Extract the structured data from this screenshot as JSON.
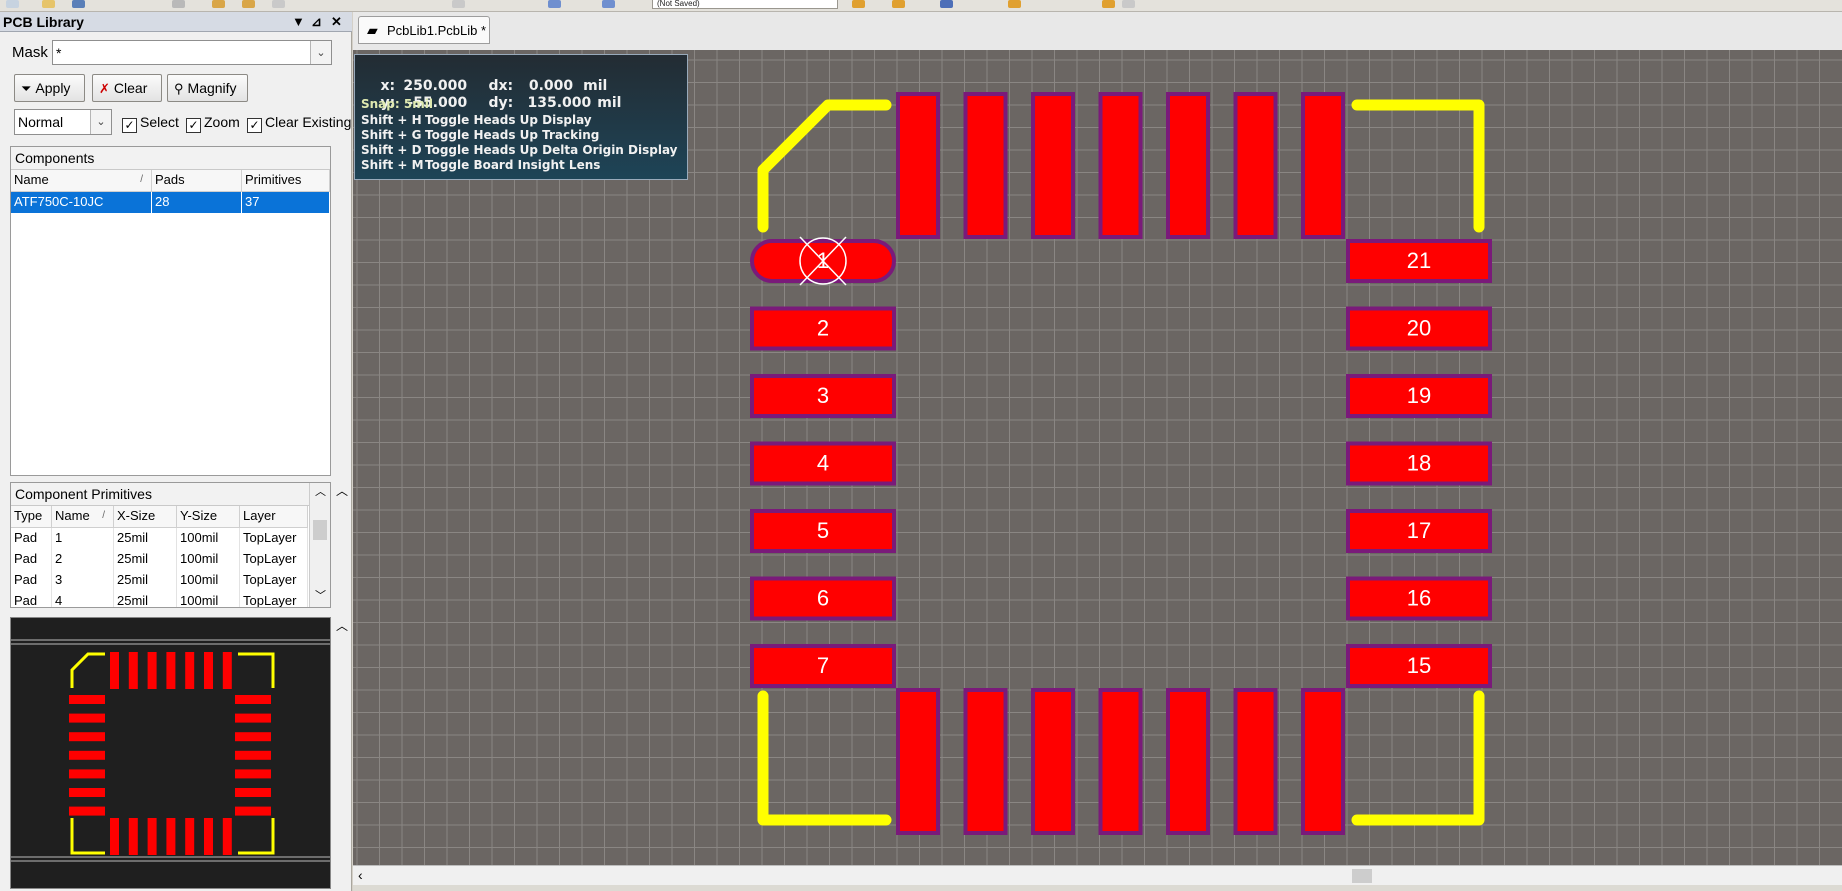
{
  "document_tab": {
    "label": "PcbLib1.PcbLib *"
  },
  "panel": {
    "title": "PCB Library",
    "mask_label": "Mask",
    "mask_value": "*",
    "buttons": {
      "apply": "Apply",
      "clear": "Clear",
      "magnify": "Magnify"
    },
    "filter_mode": "Normal",
    "checkboxes": {
      "select": "Select",
      "zoom": "Zoom",
      "clear_existing": "Clear Existing"
    },
    "components": {
      "title": "Components",
      "columns": [
        "Name",
        "Pads",
        "Primitives"
      ],
      "sort_glyph": "/",
      "rows": [
        {
          "name": "ATF750C-10JC",
          "pads": "28",
          "primitives": "37"
        }
      ]
    },
    "primitives": {
      "title": "Component Primitives",
      "columns": [
        "Type",
        "Name",
        "X-Size",
        "Y-Size",
        "Layer"
      ],
      "sort_glyph": "/",
      "rows": [
        {
          "type": "Pad",
          "name": "1",
          "xsize": "25mil",
          "ysize": "100mil",
          "layer": "TopLayer"
        },
        {
          "type": "Pad",
          "name": "2",
          "xsize": "25mil",
          "ysize": "100mil",
          "layer": "TopLayer"
        },
        {
          "type": "Pad",
          "name": "3",
          "xsize": "25mil",
          "ysize": "100mil",
          "layer": "TopLayer"
        },
        {
          "type": "Pad",
          "name": "4",
          "xsize": "25mil",
          "ysize": "100mil",
          "layer": "TopLayer"
        }
      ]
    }
  },
  "hud": {
    "x_label": "x:",
    "x_value": "250.000",
    "dx_label": "dx:",
    "dx_value": "0.000",
    "x_unit": "mil",
    "y_label": "y:",
    "y_value": "-55.000",
    "dy_label": "dy:",
    "dy_value": "135.000",
    "y_unit": "mil",
    "snap": "Snap: 5mil",
    "shortcuts": [
      {
        "keys": "Shift + H",
        "action": "Toggle Heads Up Display"
      },
      {
        "keys": "Shift + G",
        "action": "Toggle Heads Up Tracking"
      },
      {
        "keys": "Shift + D",
        "action": "Toggle Heads Up Delta Origin Display"
      },
      {
        "keys": "Shift + M",
        "action": "Toggle Board Insight Lens"
      }
    ]
  },
  "footprint": {
    "left_pads": [
      "1",
      "2",
      "3",
      "4",
      "5",
      "6",
      "7"
    ],
    "right_pads": [
      "21",
      "20",
      "19",
      "18",
      "17",
      "16",
      "15"
    ],
    "top_pad_count": 7,
    "bottom_pad_count": 7
  },
  "colors": {
    "canvas": "#6b6663",
    "grid": "#8a8683",
    "pad_fill": "#ff0000",
    "pad_outline": "#7a1a7a",
    "silkscreen": "#ffff00",
    "selection": "#0a73d8"
  },
  "toolbar": {
    "partial_field": "(Not Saved)"
  }
}
